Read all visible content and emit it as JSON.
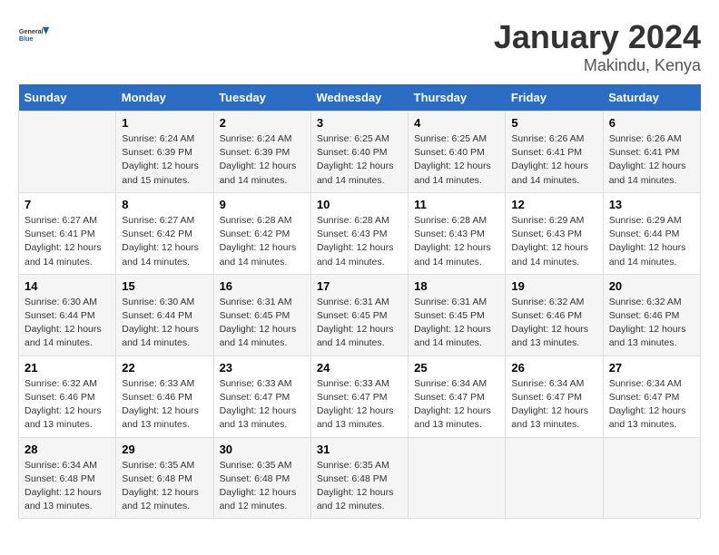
{
  "header": {
    "logo_line1": "General",
    "logo_line2": "Blue",
    "month": "January 2024",
    "location": "Makindu, Kenya"
  },
  "weekdays": [
    "Sunday",
    "Monday",
    "Tuesday",
    "Wednesday",
    "Thursday",
    "Friday",
    "Saturday"
  ],
  "weeks": [
    [
      {
        "day": "",
        "info": ""
      },
      {
        "day": "1",
        "info": "Sunrise: 6:24 AM\nSunset: 6:39 PM\nDaylight: 12 hours\nand 15 minutes."
      },
      {
        "day": "2",
        "info": "Sunrise: 6:24 AM\nSunset: 6:39 PM\nDaylight: 12 hours\nand 14 minutes."
      },
      {
        "day": "3",
        "info": "Sunrise: 6:25 AM\nSunset: 6:40 PM\nDaylight: 12 hours\nand 14 minutes."
      },
      {
        "day": "4",
        "info": "Sunrise: 6:25 AM\nSunset: 6:40 PM\nDaylight: 12 hours\nand 14 minutes."
      },
      {
        "day": "5",
        "info": "Sunrise: 6:26 AM\nSunset: 6:41 PM\nDaylight: 12 hours\nand 14 minutes."
      },
      {
        "day": "6",
        "info": "Sunrise: 6:26 AM\nSunset: 6:41 PM\nDaylight: 12 hours\nand 14 minutes."
      }
    ],
    [
      {
        "day": "7",
        "info": "Sunrise: 6:27 AM\nSunset: 6:41 PM\nDaylight: 12 hours\nand 14 minutes."
      },
      {
        "day": "8",
        "info": "Sunrise: 6:27 AM\nSunset: 6:42 PM\nDaylight: 12 hours\nand 14 minutes."
      },
      {
        "day": "9",
        "info": "Sunrise: 6:28 AM\nSunset: 6:42 PM\nDaylight: 12 hours\nand 14 minutes."
      },
      {
        "day": "10",
        "info": "Sunrise: 6:28 AM\nSunset: 6:43 PM\nDaylight: 12 hours\nand 14 minutes."
      },
      {
        "day": "11",
        "info": "Sunrise: 6:28 AM\nSunset: 6:43 PM\nDaylight: 12 hours\nand 14 minutes."
      },
      {
        "day": "12",
        "info": "Sunrise: 6:29 AM\nSunset: 6:43 PM\nDaylight: 12 hours\nand 14 minutes."
      },
      {
        "day": "13",
        "info": "Sunrise: 6:29 AM\nSunset: 6:44 PM\nDaylight: 12 hours\nand 14 minutes."
      }
    ],
    [
      {
        "day": "14",
        "info": "Sunrise: 6:30 AM\nSunset: 6:44 PM\nDaylight: 12 hours\nand 14 minutes."
      },
      {
        "day": "15",
        "info": "Sunrise: 6:30 AM\nSunset: 6:44 PM\nDaylight: 12 hours\nand 14 minutes."
      },
      {
        "day": "16",
        "info": "Sunrise: 6:31 AM\nSunset: 6:45 PM\nDaylight: 12 hours\nand 14 minutes."
      },
      {
        "day": "17",
        "info": "Sunrise: 6:31 AM\nSunset: 6:45 PM\nDaylight: 12 hours\nand 14 minutes."
      },
      {
        "day": "18",
        "info": "Sunrise: 6:31 AM\nSunset: 6:45 PM\nDaylight: 12 hours\nand 14 minutes."
      },
      {
        "day": "19",
        "info": "Sunrise: 6:32 AM\nSunset: 6:46 PM\nDaylight: 12 hours\nand 13 minutes."
      },
      {
        "day": "20",
        "info": "Sunrise: 6:32 AM\nSunset: 6:46 PM\nDaylight: 12 hours\nand 13 minutes."
      }
    ],
    [
      {
        "day": "21",
        "info": "Sunrise: 6:32 AM\nSunset: 6:46 PM\nDaylight: 12 hours\nand 13 minutes."
      },
      {
        "day": "22",
        "info": "Sunrise: 6:33 AM\nSunset: 6:46 PM\nDaylight: 12 hours\nand 13 minutes."
      },
      {
        "day": "23",
        "info": "Sunrise: 6:33 AM\nSunset: 6:47 PM\nDaylight: 12 hours\nand 13 minutes."
      },
      {
        "day": "24",
        "info": "Sunrise: 6:33 AM\nSunset: 6:47 PM\nDaylight: 12 hours\nand 13 minutes."
      },
      {
        "day": "25",
        "info": "Sunrise: 6:34 AM\nSunset: 6:47 PM\nDaylight: 12 hours\nand 13 minutes."
      },
      {
        "day": "26",
        "info": "Sunrise: 6:34 AM\nSunset: 6:47 PM\nDaylight: 12 hours\nand 13 minutes."
      },
      {
        "day": "27",
        "info": "Sunrise: 6:34 AM\nSunset: 6:47 PM\nDaylight: 12 hours\nand 13 minutes."
      }
    ],
    [
      {
        "day": "28",
        "info": "Sunrise: 6:34 AM\nSunset: 6:48 PM\nDaylight: 12 hours\nand 13 minutes."
      },
      {
        "day": "29",
        "info": "Sunrise: 6:35 AM\nSunset: 6:48 PM\nDaylight: 12 hours\nand 12 minutes."
      },
      {
        "day": "30",
        "info": "Sunrise: 6:35 AM\nSunset: 6:48 PM\nDaylight: 12 hours\nand 12 minutes."
      },
      {
        "day": "31",
        "info": "Sunrise: 6:35 AM\nSunset: 6:48 PM\nDaylight: 12 hours\nand 12 minutes."
      },
      {
        "day": "",
        "info": ""
      },
      {
        "day": "",
        "info": ""
      },
      {
        "day": "",
        "info": ""
      }
    ]
  ]
}
